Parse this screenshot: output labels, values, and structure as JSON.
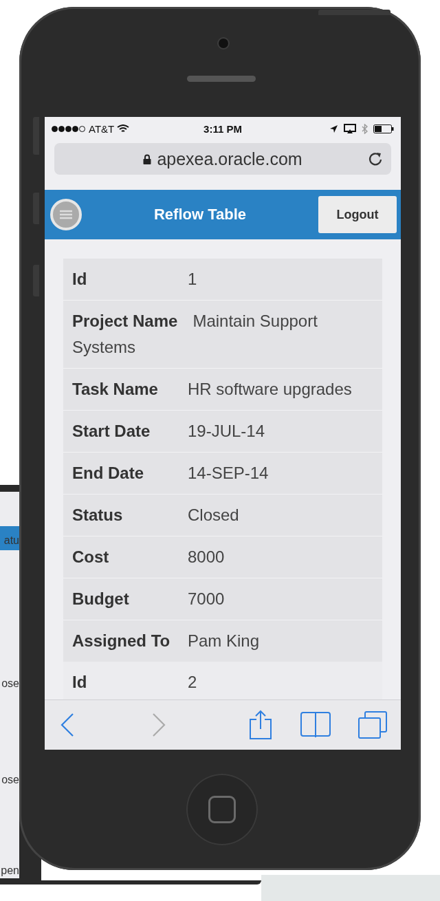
{
  "background_screen": {
    "fragments": [
      "atu",
      "ose",
      "ose",
      "pen"
    ]
  },
  "status_bar": {
    "carrier": "AT&T",
    "time": "3:11 PM"
  },
  "browser": {
    "url": "apexea.oracle.com"
  },
  "header": {
    "title": "Reflow Table",
    "logout": "Logout"
  },
  "records": [
    {
      "fields": [
        {
          "label": "Id",
          "value": "1"
        },
        {
          "label": "Project Name",
          "value": "Maintain Support Systems"
        },
        {
          "label": "Task Name",
          "value": "HR software upgrades"
        },
        {
          "label": "Start Date",
          "value": "19-JUL-14"
        },
        {
          "label": "End Date",
          "value": "14-SEP-14"
        },
        {
          "label": "Status",
          "value": "Closed"
        },
        {
          "label": "Cost",
          "value": "8000"
        },
        {
          "label": "Budget",
          "value": "7000"
        },
        {
          "label": "Assigned To",
          "value": "Pam King"
        }
      ]
    },
    {
      "fields": [
        {
          "label": "Id",
          "value": "2"
        }
      ]
    }
  ]
}
